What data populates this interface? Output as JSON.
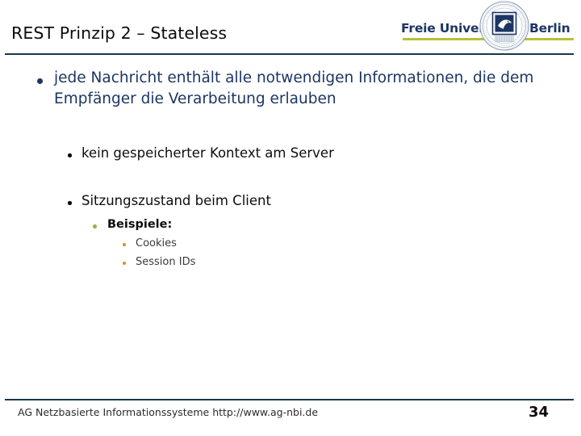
{
  "header": {
    "title": "REST Prinzip 2 – Stateless",
    "rule_color": "#17374d"
  },
  "logo": {
    "text_left": "Freie Universität",
    "text_right": "Berlin",
    "seal_label": "fu-berlin-seal",
    "underline_color": "#b5c13a",
    "text_color": "#1c3664"
  },
  "body": {
    "bullets": [
      {
        "level": 1,
        "text": "jede Nachricht enthält alle notwendigen Informationen, die dem Empfänger die Verarbeitung erlauben",
        "bullet_color": "#1c3664",
        "text_color": "#1c3664"
      },
      {
        "level": 2,
        "text": "kein gespeicherter Kontext am Server",
        "bullet_color": "#0d0d0d",
        "text_color": "#0d0d0d"
      },
      {
        "level": 2,
        "text": "Sitzungszustand beim Client",
        "bullet_color": "#0d0d0d",
        "text_color": "#0d0d0d"
      },
      {
        "level": 3,
        "text": "Beispiele:",
        "bullet_color": "#94b348",
        "text_color": "#0d0d0d"
      },
      {
        "level": 4,
        "text": "Cookies",
        "bullet_color": "#e08b30",
        "text_color": "#3b3b3b"
      },
      {
        "level": 4,
        "text": "Session IDs",
        "bullet_color": "#e08b30",
        "text_color": "#3b3b3b"
      }
    ]
  },
  "footer": {
    "text": "AG Netzbasierte Informationssysteme http://www.ag-nbi.de",
    "page_number": "34",
    "rule_color": "#17374d"
  }
}
